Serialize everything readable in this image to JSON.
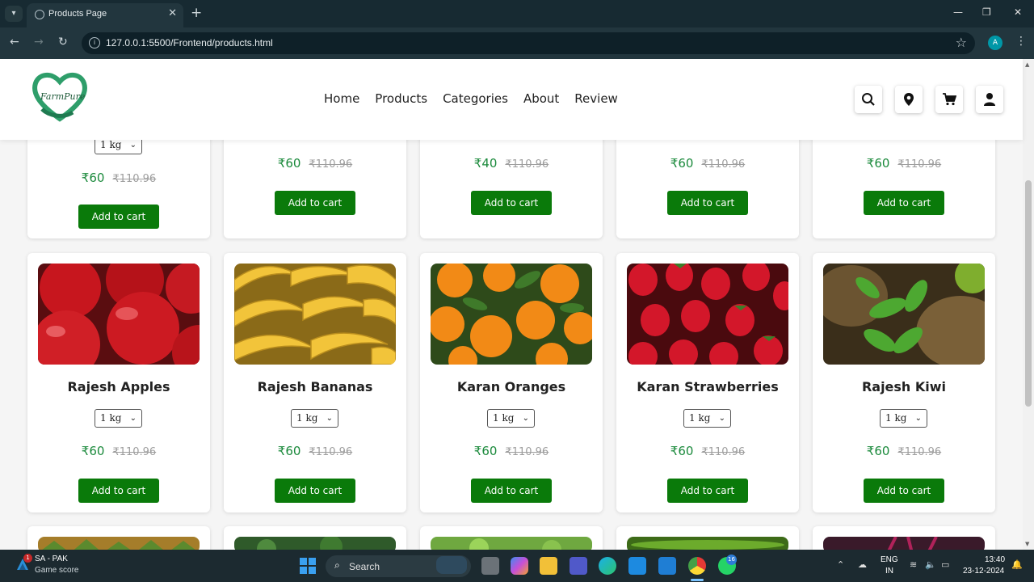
{
  "browser": {
    "tab_title": "Products Page",
    "url": "127.0.0.1:5500/Frontend/products.html",
    "profile_initial": "A"
  },
  "header": {
    "nav": [
      "Home",
      "Products",
      "Categories",
      "About",
      "Review"
    ],
    "icons": [
      "search-icon",
      "location-pin-icon",
      "cart-icon",
      "user-icon"
    ]
  },
  "top_row": [
    {
      "qty": "1 kg",
      "price": "₹60",
      "old_price": "₹110.96",
      "button": "Add to cart"
    },
    {
      "price": "₹60",
      "old_price": "₹110.96",
      "button": "Add to cart"
    },
    {
      "price": "₹40",
      "old_price": "₹110.96",
      "button": "Add to cart"
    },
    {
      "price": "₹60",
      "old_price": "₹110.96",
      "button": "Add to cart"
    },
    {
      "price": "₹60",
      "old_price": "₹110.96",
      "button": "Add to cart"
    }
  ],
  "products": [
    {
      "name": "Rajesh Apples",
      "qty": "1 kg",
      "price": "₹60",
      "old_price": "₹110.96",
      "button": "Add to cart",
      "image": "apples"
    },
    {
      "name": "Rajesh Bananas",
      "qty": "1 kg",
      "price": "₹60",
      "old_price": "₹110.96",
      "button": "Add to cart",
      "image": "bananas"
    },
    {
      "name": "Karan Oranges",
      "qty": "1 kg",
      "price": "₹60",
      "old_price": "₹110.96",
      "button": "Add to cart",
      "image": "oranges"
    },
    {
      "name": "Karan Strawberries",
      "qty": "1 kg",
      "price": "₹60",
      "old_price": "₹110.96",
      "button": "Add to cart",
      "image": "strawberries"
    },
    {
      "name": "Rajesh Kiwi",
      "qty": "1 kg",
      "price": "₹60",
      "old_price": "₹110.96",
      "button": "Add to cart",
      "image": "kiwi"
    }
  ],
  "taskbar": {
    "weather_badge": "1",
    "weather_title": "SA - PAK",
    "weather_sub": "Game score",
    "search_label": "Search",
    "whatsapp_badge": "16",
    "lang_top": "ENG",
    "lang_bottom": "IN",
    "time": "13:40",
    "date": "23-12-2024"
  },
  "colors": {
    "accent": "#0a7a0a",
    "price_green": "#1b8a3c"
  }
}
